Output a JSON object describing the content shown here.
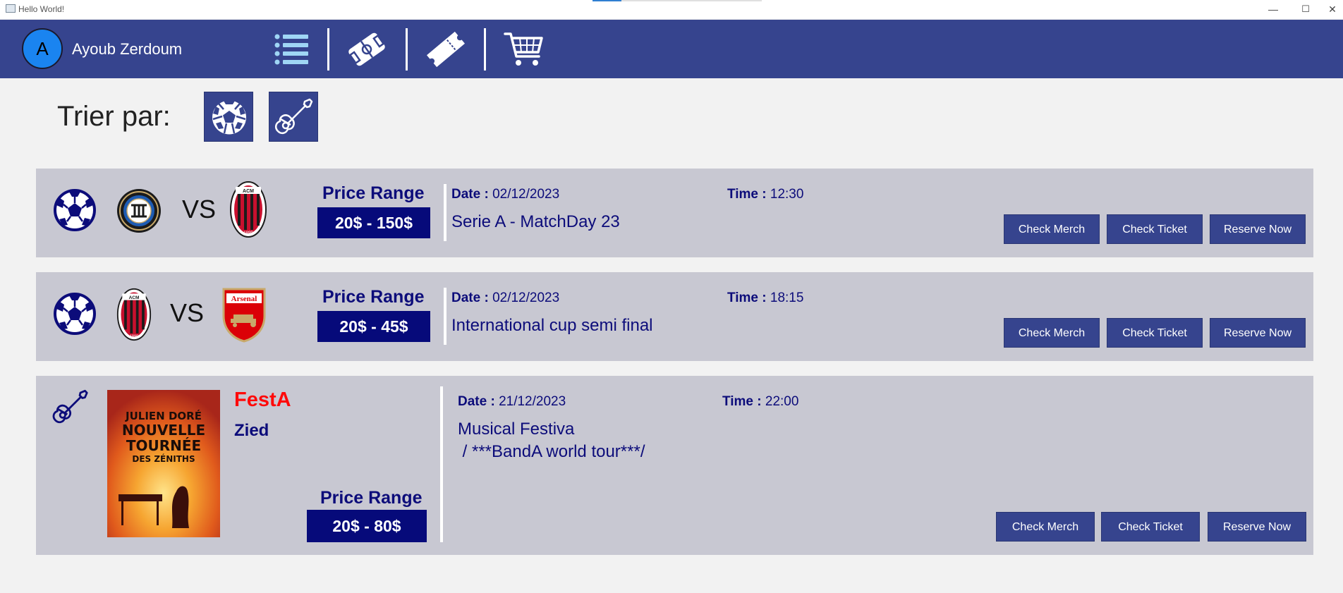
{
  "window": {
    "title": "Hello World!",
    "loading_progress": 0.17,
    "controls": {
      "minimize": "—",
      "maximize": "☐",
      "close": "✕"
    }
  },
  "header": {
    "avatar_letter": "A",
    "user_name": "Ayoub Zerdoum",
    "nav_icons": [
      "list-icon",
      "stadium-icon",
      "ticket-icon",
      "cart-icon"
    ],
    "colors": {
      "bar": "#36448e",
      "avatar": "#1a84f0"
    }
  },
  "filter": {
    "label": "Trier par:",
    "options": [
      "soccer-ball-icon",
      "guitar-icon"
    ]
  },
  "events": [
    {
      "type": "match",
      "category_icon": "soccer-ball-icon",
      "team_home_logo": "inter-milan-logo",
      "vs_text": "VS",
      "team_away_logo": "ac-milan-logo",
      "price_title": "Price Range",
      "price_range": "20$ - 150$",
      "date_label": "Date :",
      "date": "02/12/2023",
      "time_label": "Time :",
      "time": "12:30",
      "description": "Serie A - MatchDay 23",
      "buttons": [
        "Check Merch",
        "Check Ticket",
        "Reserve Now"
      ]
    },
    {
      "type": "match",
      "category_icon": "soccer-ball-icon",
      "team_home_logo": "ac-milan-logo",
      "vs_text": "VS",
      "team_away_logo": "arsenal-logo",
      "price_title": "Price Range",
      "price_range": "20$ - 45$",
      "date_label": "Date :",
      "date": "02/12/2023",
      "time_label": "Time :",
      "time": "18:15",
      "description": "International cup semi final",
      "buttons": [
        "Check Merch",
        "Check Ticket",
        "Reserve Now"
      ]
    },
    {
      "type": "concert",
      "category_icon": "guitar-icon",
      "poster_text": [
        "JULIEN DORÉ",
        "NOUVELLE",
        "TOURNÉE",
        "DES ZÉNITHS"
      ],
      "event_name": "FestA",
      "artist": "Zied",
      "price_title": "Price Range",
      "price_range": "20$ - 80$",
      "date_label": "Date :",
      "date": "21/12/2023",
      "time_label": "Time :",
      "time": "22:00",
      "description_lines": [
        "Musical Festiva",
        " / ***BandA world tour***/"
      ],
      "buttons": [
        "Check Merch",
        "Check Ticket",
        "Reserve Now"
      ]
    }
  ]
}
